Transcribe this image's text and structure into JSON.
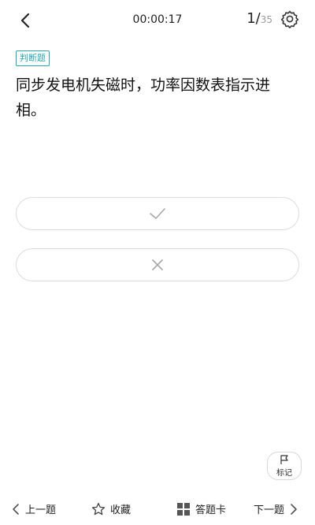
{
  "header": {
    "timer": "00:00:17",
    "current_index": "1/",
    "total": "35"
  },
  "question": {
    "type_label": "判断题",
    "text": "同步发电机失磁时，功率因数表指示进相。"
  },
  "options": {
    "true_icon": "check-icon",
    "false_icon": "close-icon"
  },
  "mark": {
    "label": "标记",
    "icon": "flag-icon"
  },
  "bottom_bar": {
    "prev_label": "上一题",
    "favorite_label": "收藏",
    "answer_card_label": "答题卡",
    "next_label": "下一题"
  },
  "colors": {
    "accent": "#2aa6b0",
    "border": "#dcdcdc",
    "icon_gray": "#a8a8a8"
  }
}
